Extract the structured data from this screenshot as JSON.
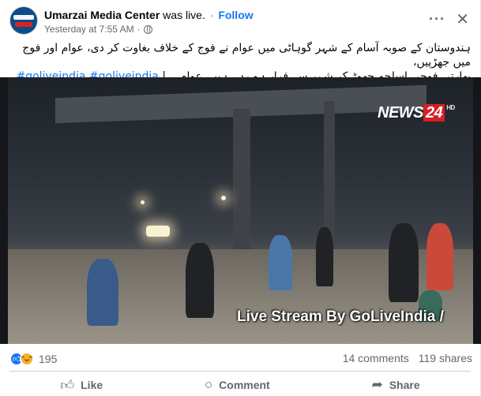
{
  "post": {
    "page_name": "Umarzai Media Center",
    "status_text": "was live.",
    "follow_label": "Follow",
    "timestamp": "Yesterday at 7:55 AM",
    "separator": "·",
    "more_icon": "more-horizontal-icon",
    "close_icon": "close-icon",
    "caption_line1": "ہندوستان کے صوبہ آسام کے شہر گوہاٹی میں عوام نے فوج کے خلاف بغاوت کر دی، عوام اور فوج میں جھڑپیں،",
    "caption_line2_text": "بھارتی فوجی اسلحہ چھوڑ کر شہر سے فرار ہو رہے ہیں، عوام... |",
    "caption_tags": "#goliveindia #goliveindia",
    "video": {
      "channel_logo_prefix": "NEWS",
      "channel_logo_number": "24",
      "channel_logo_suffix": "HD",
      "overlay_text": "Live Stream By GoLiveIndia /"
    },
    "reactions": {
      "count": "195",
      "types": [
        "like",
        "haha"
      ],
      "comments": "14 comments",
      "shares": "119 shares"
    },
    "actions": [
      {
        "label": "Like",
        "icon": "thumbs-up-icon"
      },
      {
        "label": "Comment",
        "icon": "comment-icon"
      },
      {
        "label": "Share",
        "icon": "share-icon"
      }
    ]
  },
  "colors": {
    "accent": "#1877f2",
    "secondary_text": "#65676b",
    "channel_red": "#d81e25"
  }
}
